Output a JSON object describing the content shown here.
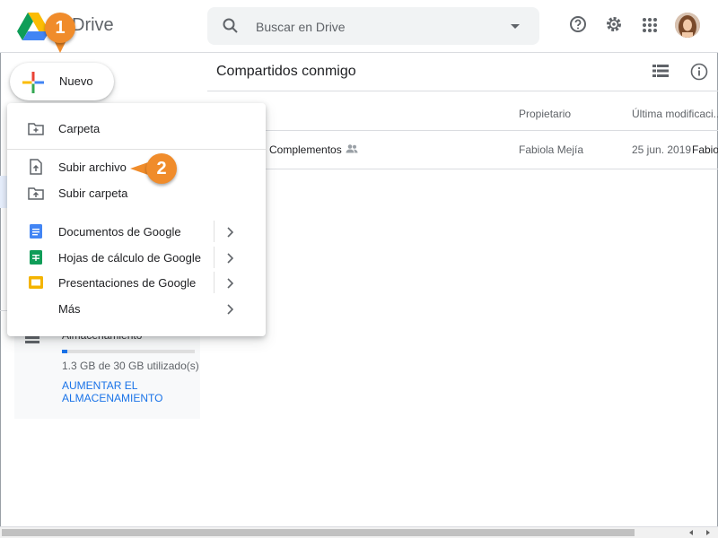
{
  "app": {
    "logo_text": "Drive"
  },
  "search": {
    "placeholder": "Buscar en Drive"
  },
  "header_icons": [
    "help-icon",
    "settings-icon",
    "apps-grid-icon"
  ],
  "new_button": {
    "label": "Nuevo"
  },
  "page": {
    "title": "Compartidos conmigo"
  },
  "table": {
    "columns": [
      "Propietario",
      "Última modificaci..."
    ],
    "rows": [
      {
        "name": "Complementos",
        "owner": "Fabiola Mejía",
        "modified": "25 jun. 2019",
        "modified_by": "Fabio"
      }
    ]
  },
  "menu": {
    "items": [
      {
        "label": "Carpeta",
        "icon": "folder-plus-icon"
      },
      {
        "label": "Subir archivo",
        "icon": "file-upload-icon"
      },
      {
        "label": "Subir carpeta",
        "icon": "folder-upload-icon"
      },
      {
        "label": "Documentos de Google",
        "icon": "google-docs-icon",
        "submenu": true
      },
      {
        "label": "Hojas de cálculo de Google",
        "icon": "google-sheets-icon",
        "submenu": true
      },
      {
        "label": "Presentaciones de Google",
        "icon": "google-slides-icon",
        "submenu": true
      },
      {
        "label": "Más",
        "icon": "",
        "submenu": true
      }
    ]
  },
  "storage": {
    "label": "Almacenamiento",
    "used_text": "1.3 GB de 30 GB utilizado(s)",
    "used_fraction": 0.043,
    "upgrade_label": "AUMENTAR EL ALMACENAMIENTO"
  },
  "callouts": {
    "step1": "1",
    "step2": "2"
  },
  "colors": {
    "accent": "#1a73e8",
    "callout": "#f08c2b",
    "docs": "#4285f4",
    "sheets": "#0f9d58",
    "slides": "#f4b400"
  }
}
